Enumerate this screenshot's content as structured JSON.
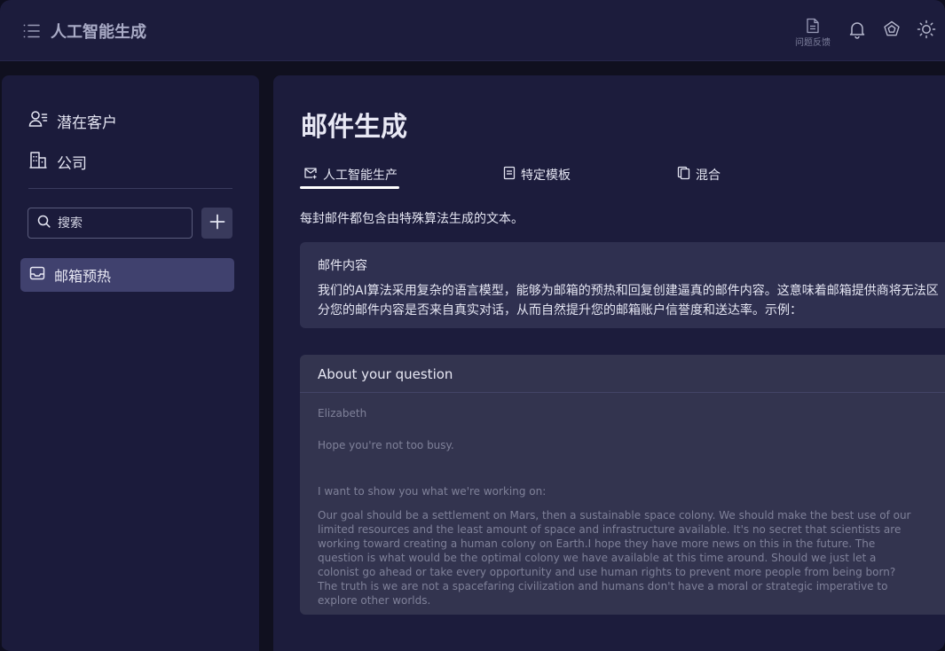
{
  "app": {
    "title": "人工智能生成"
  },
  "topbar": {
    "feedback_label": "问题反馈"
  },
  "sidebar": {
    "nav": [
      {
        "label": "潜在客户",
        "icon": "user-list-icon"
      },
      {
        "label": "公司",
        "icon": "building-icon"
      }
    ],
    "search": {
      "placeholder": "搜索",
      "value": ""
    },
    "folders": [
      {
        "label": "邮箱预热",
        "icon": "inbox-icon",
        "selected": true
      }
    ]
  },
  "main": {
    "title": "邮件生成",
    "tabs": [
      {
        "label": "人工智能生产",
        "icon": "mail-sparkle-icon",
        "active": true
      },
      {
        "label": "特定模板",
        "icon": "document-icon",
        "active": false
      },
      {
        "label": "混合",
        "icon": "copy-icon",
        "active": false
      }
    ],
    "description": "每封邮件都包含由特殊算法生成的文本。",
    "info_card": {
      "title": "邮件内容",
      "body": "我们的AI算法采用复杂的语言模型，能够为邮箱的预热和回复创建逼真的邮件内容。这意味着邮箱提供商将无法区分您的邮件内容是否来自真实对话，从而自然提升您的邮箱账户信誉度和送达率。示例："
    },
    "email_example": {
      "subject": "About your question",
      "greeting": "Elizabeth",
      "line2": "Hope you're not too busy.",
      "line3": "I want to show you what we're working on:",
      "paragraph": "Our goal should be a settlement on Mars, then a sustainable space colony. We should make the best use of our limited resources and the least amount of space and infrastructure available. It's no secret that scientists are working toward creating a human colony on Earth.I hope they have more news on this in the future. The question is what would be the optimal colony we have available at this time around. Should we just let a colonist go ahead or take every opportunity and use human rights to prevent more people from being born? The truth is we are not a spacefaring civilization and humans don't have a moral or strategic imperative to explore other worlds."
    }
  },
  "colors": {
    "background": "#10101f",
    "panel": "#1c1c3c",
    "selected": "#40416e",
    "card": "#2f3050",
    "muted_text": "#7f8199"
  }
}
